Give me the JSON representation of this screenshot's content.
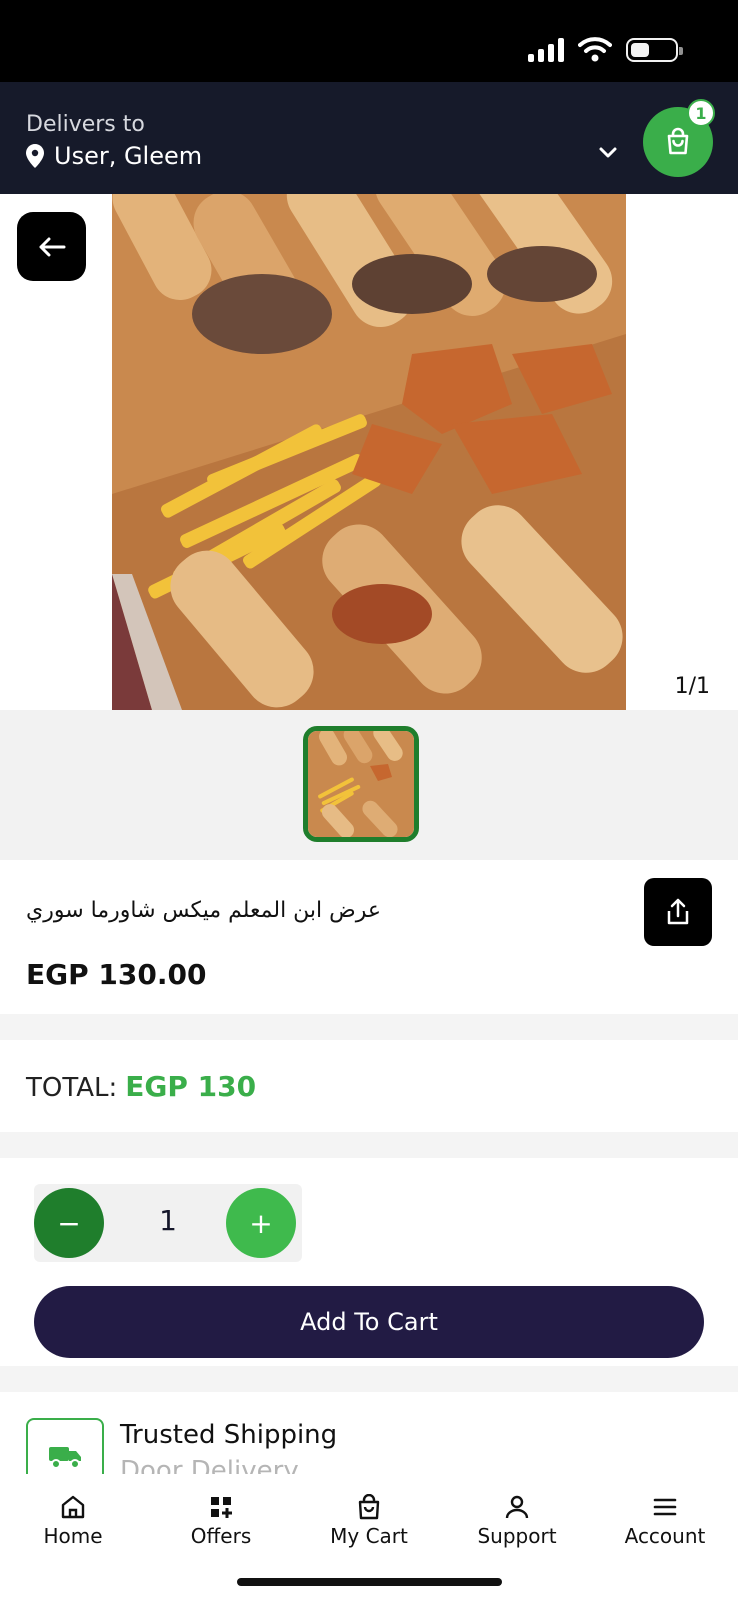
{
  "header": {
    "deliver_label": "Delivers to",
    "deliver_user": "User, Gleem",
    "cart_count": "1"
  },
  "gallery": {
    "counter": "1/1"
  },
  "product": {
    "name": "عرض ابن المعلم ميكس شاورما سوري",
    "price": "EGP 130.00"
  },
  "total": {
    "label": "TOTAL:",
    "value": "EGP 130"
  },
  "quantity": {
    "value": "1",
    "minus": "−",
    "plus": "+"
  },
  "actions": {
    "add_to_cart": "Add To Cart"
  },
  "shipping": {
    "title": "Trusted Shipping",
    "subtitle": "Door Delivery"
  },
  "nav": {
    "items": [
      {
        "label": "Home",
        "icon": "home-icon"
      },
      {
        "label": "Offers",
        "icon": "offers-grid-icon"
      },
      {
        "label": "My Cart",
        "icon": "cart-bag-icon"
      },
      {
        "label": "Support",
        "icon": "user-icon"
      },
      {
        "label": "Account",
        "icon": "menu-icon"
      }
    ]
  },
  "colors": {
    "brand_green": "#3aae4a",
    "dark_green": "#1f7e2c",
    "header_bg": "#161a2a",
    "primary_button": "#221b44"
  }
}
